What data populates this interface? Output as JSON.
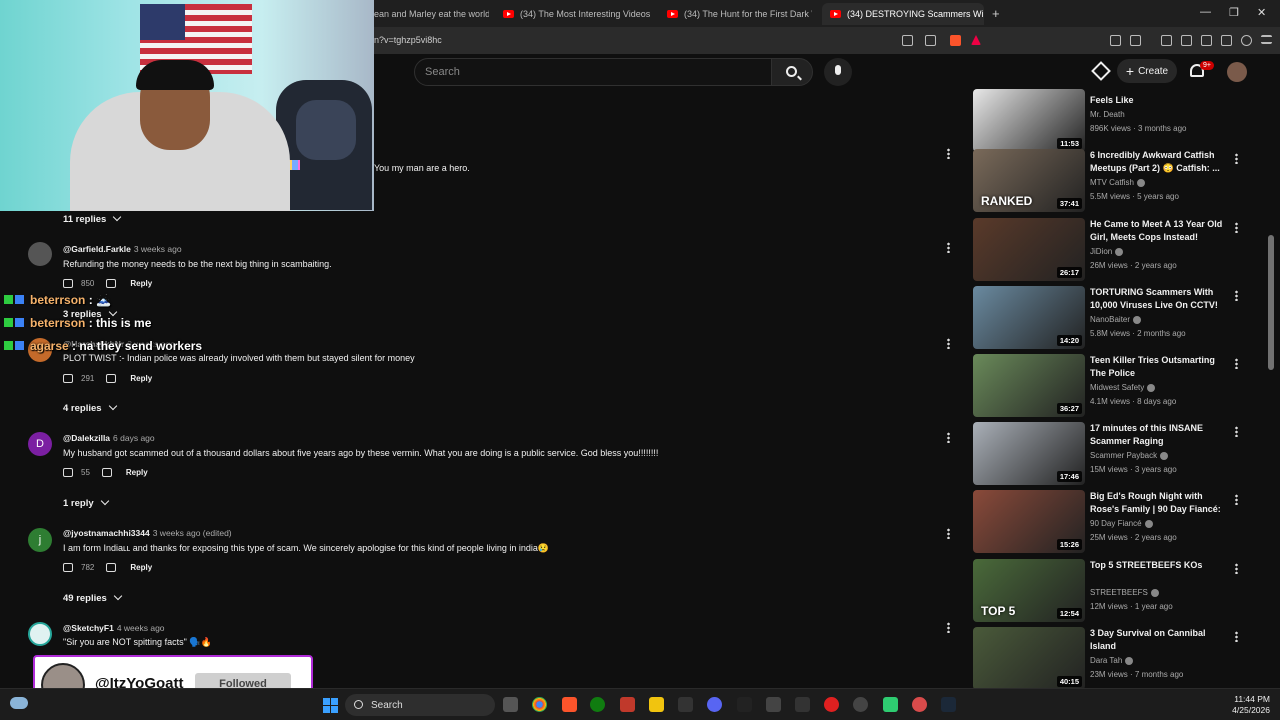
{
  "browser": {
    "tabs": [
      {
        "title": "ean and Marley eat the world's"
      },
      {
        "title": "(34) The Most Interesting Videos on"
      },
      {
        "title": "(34) The Hunt for the First Dark Web"
      },
      {
        "title": "(34) DESTROYING Scammers Wi"
      }
    ],
    "url": "n?v=tghzp5vi8hc"
  },
  "youtube": {
    "search_placeholder": "Search",
    "create_label": "Create",
    "notif_count": "9+"
  },
  "comments": {
    "first_line": "You my man are a hero.",
    "items": [
      {
        "replies": "11 replies"
      },
      {
        "avatar": "",
        "author": "@Garfield.Farkle",
        "time": "3 weeks ago",
        "text": "Refunding the money needs to be the next big thing in scambaiting.",
        "likes": "850",
        "reply": "Reply",
        "replies": "3 replies"
      },
      {
        "avatar": "",
        "author": "@HarshakkhNr",
        "time": "3 weeks ago",
        "text": "PLOT TWIST :- Indian police was already involved with them but stayed silent for money",
        "likes": "291",
        "reply": "Reply",
        "replies": "4 replies"
      },
      {
        "avatar": "D",
        "author": "@Dalekzilla",
        "time": "6 days ago",
        "text": "My husband got scammed out of a thousand dollars about five years ago by these vermin. What you are doing is a public service. God bless you!!!!!!!!",
        "likes": "55",
        "reply": "Reply",
        "replies": "1 reply"
      },
      {
        "avatar": "j",
        "author": "@jyostnamachhi3344",
        "time": "3 weeks ago (edited)",
        "text": "I am form Indiaʟʟ and thanks for exposing this type of scam. We sincerely apologise for this kind of people living in india😢",
        "likes": "782",
        "reply": "Reply",
        "replies": "49 replies"
      },
      {
        "avatar": "",
        "author": "@SketchyF1",
        "time": "4 weeks ago",
        "text": "\"Sir you are NOT spitting facts\" 🗣️🔥"
      }
    ]
  },
  "chat": [
    {
      "user": "beterrson",
      "msg": "🗻"
    },
    {
      "user": "beterrson",
      "msg": "this is me"
    },
    {
      "user": "agarse",
      "msg": "na they send workers"
    }
  ],
  "sidebar": [
    {
      "title": "Feels Like",
      "channel": "Mr. Death",
      "stats": "896K views · 3 months ago",
      "duration": "11:53",
      "verified": false,
      "color": "#e8e8e8"
    },
    {
      "title": "6 Incredibly Awkward Catfish Meetups (Part 2) 😳 Catfish: ...",
      "channel": "MTV Catfish",
      "stats": "5.5M views · 5 years ago",
      "duration": "37:41",
      "verified": true,
      "color": "#7a6a5a",
      "thumb_text": "RANKED"
    },
    {
      "title": "He Came to Meet A 13 Year Old Girl, Meets Cops Instead!",
      "channel": "JiDion",
      "stats": "26M views · 2 years ago",
      "duration": "26:17",
      "verified": true,
      "color": "#5a3a2a"
    },
    {
      "title": "TORTURING Scammers With 10,000 Viruses Live On CCTV!",
      "channel": "NanoBaiter",
      "stats": "5.8M views · 2 months ago",
      "duration": "14:20",
      "verified": true,
      "color": "#6a8aa0"
    },
    {
      "title": "Teen Killer Tries Outsmarting The Police",
      "channel": "Midwest Safety",
      "stats": "4.1M views · 8 days ago",
      "duration": "36:27",
      "verified": true,
      "color": "#6a8a5a"
    },
    {
      "title": "17 minutes of this INSANE Scammer Raging",
      "channel": "Scammer Payback",
      "stats": "15M views · 3 years ago",
      "duration": "17:46",
      "verified": true,
      "color": "#aab0b8"
    },
    {
      "title": "Big Ed's Rough Night with Rose's Family | 90 Day Fiancé: ...",
      "channel": "90 Day Fiancé",
      "stats": "25M views · 2 years ago",
      "duration": "15:26",
      "verified": true,
      "color": "#8a4a3a"
    },
    {
      "title": "Top 5 STREETBEEFS KOs",
      "channel": "STREETBEEFS",
      "stats": "12M views · 1 year ago",
      "duration": "12:54",
      "verified": true,
      "color": "#4a6a3a",
      "thumb_text": "TOP 5"
    },
    {
      "title": "3 Day Survival on Cannibal Island",
      "channel": "Dara Tah",
      "stats": "23M views · 7 months ago",
      "duration": "40:15",
      "verified": true,
      "color": "#4a5a3a"
    }
  ],
  "follow_popup": {
    "name": "@ItzYoGoatt",
    "button": "Followed"
  },
  "taskbar": {
    "search": "Search",
    "time": "11:44 PM",
    "date": "4/25/2026"
  }
}
